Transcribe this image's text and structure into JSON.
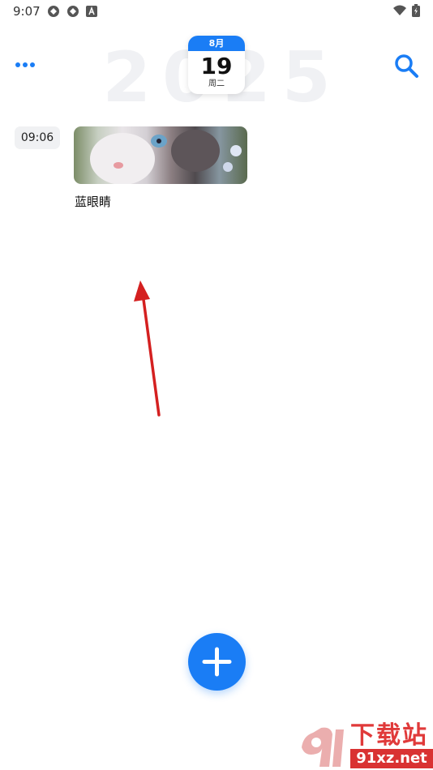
{
  "status_bar": {
    "time": "9:07",
    "left_icons": [
      "sync-icon",
      "sync-icon",
      "app-a-icon"
    ],
    "right_icons": [
      "wifi-icon",
      "battery-icon"
    ]
  },
  "header": {
    "year": "2025",
    "calendar": {
      "month": "8月",
      "day": "19",
      "weekday": "周二"
    },
    "menu_icon": "more-dots-icon",
    "search_icon": "search-icon"
  },
  "entries": [
    {
      "time": "09:06",
      "title": "蓝眼睛",
      "image": "cat-blue-eyes-photo"
    }
  ],
  "fab": {
    "icon": "plus-icon"
  },
  "watermark": {
    "text": "下载站",
    "url": "91xz.net"
  },
  "colors": {
    "accent": "#1a7df5",
    "watermark_red": "#e03a3a"
  }
}
